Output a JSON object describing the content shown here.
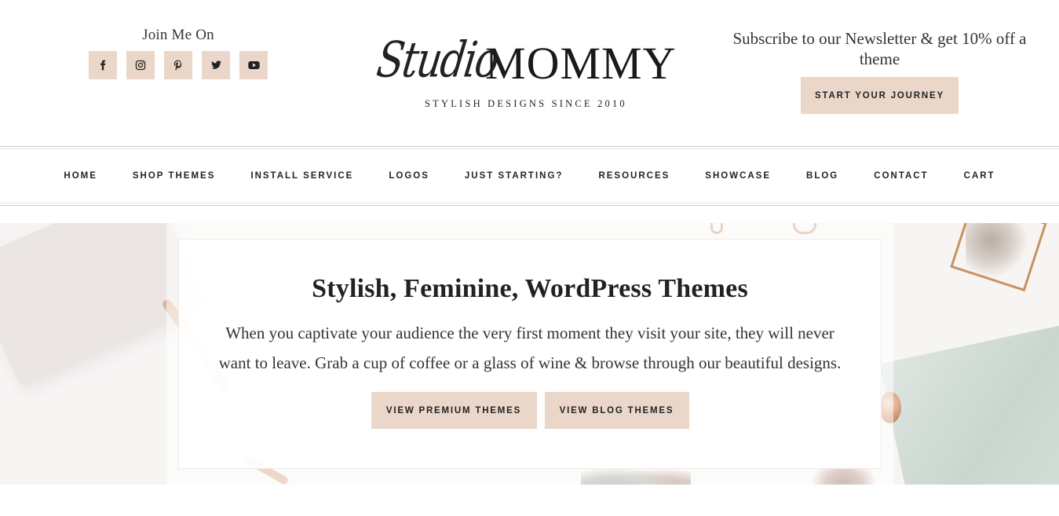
{
  "social": {
    "title": "Join Me On",
    "icons": [
      "facebook-icon",
      "instagram-icon",
      "pinterest-icon",
      "twitter-icon",
      "youtube-icon"
    ]
  },
  "logo": {
    "script": "Studio",
    "main": "MOMMY",
    "tagline": "STYLISH DESIGNS SINCE 2010"
  },
  "newsletter": {
    "text": "Subscribe to our Newsletter & get 10% off a theme",
    "button": "START YOUR JOURNEY"
  },
  "nav": {
    "items": [
      "HOME",
      "SHOP THEMES",
      "INSTALL SERVICE",
      "LOGOS",
      "JUST STARTING?",
      "RESOURCES",
      "SHOWCASE",
      "BLOG",
      "CONTACT",
      "CART"
    ]
  },
  "hero": {
    "title": "Stylish, Feminine, WordPress Themes",
    "text": "When you captivate your audience the very first moment they visit your site, they will never want to leave. Grab a cup of coffee or a glass of wine & browse through our beautiful designs.",
    "buttons": {
      "premium": "VIEW PREMIUM THEMES",
      "blog": "VIEW BLOG THEMES"
    }
  },
  "colors": {
    "accent": "#ead7ca",
    "text": "#222222"
  }
}
